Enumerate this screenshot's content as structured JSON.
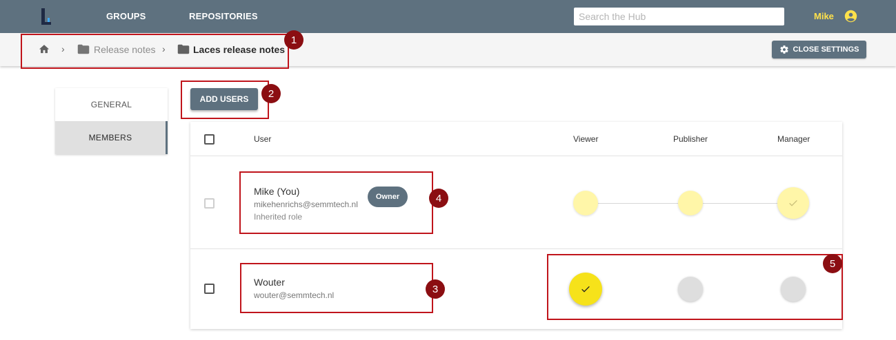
{
  "topbar": {
    "logo_icon": "laces-logo",
    "nav": [
      "GROUPS",
      "REPOSITORIES"
    ],
    "search_placeholder": "Search the Hub",
    "username": "Mike",
    "user_icon": "account-circle-icon"
  },
  "breadcrumb": {
    "home_icon": "home-icon",
    "items": [
      "Release notes",
      "Laces release notes"
    ],
    "close_settings_label": "CLOSE SETTINGS"
  },
  "tabs": [
    "GENERAL",
    "MEMBERS"
  ],
  "active_tab": "MEMBERS",
  "add_users_label": "ADD USERS",
  "table": {
    "columns": [
      "User",
      "Viewer",
      "Publisher",
      "Manager"
    ],
    "rows": [
      {
        "name": "Mike (You)",
        "email": "mikehenrichs@semmtech.nl",
        "note": "Inherited role",
        "badge": "Owner",
        "role": "Manager",
        "inherited": true
      },
      {
        "name": "Wouter",
        "email": "wouter@semmtech.nl",
        "role": "Viewer",
        "inherited": false
      }
    ]
  },
  "annotations": [
    "1",
    "2",
    "3",
    "4",
    "5"
  ],
  "colors": {
    "topbar": "#5e717f",
    "accent_yellow": "#f6e21a",
    "pale_yellow": "#fff6a8",
    "username": "#ffe14b",
    "annotation_red": "#c0141b",
    "annotation_badge": "#8b0e12"
  }
}
